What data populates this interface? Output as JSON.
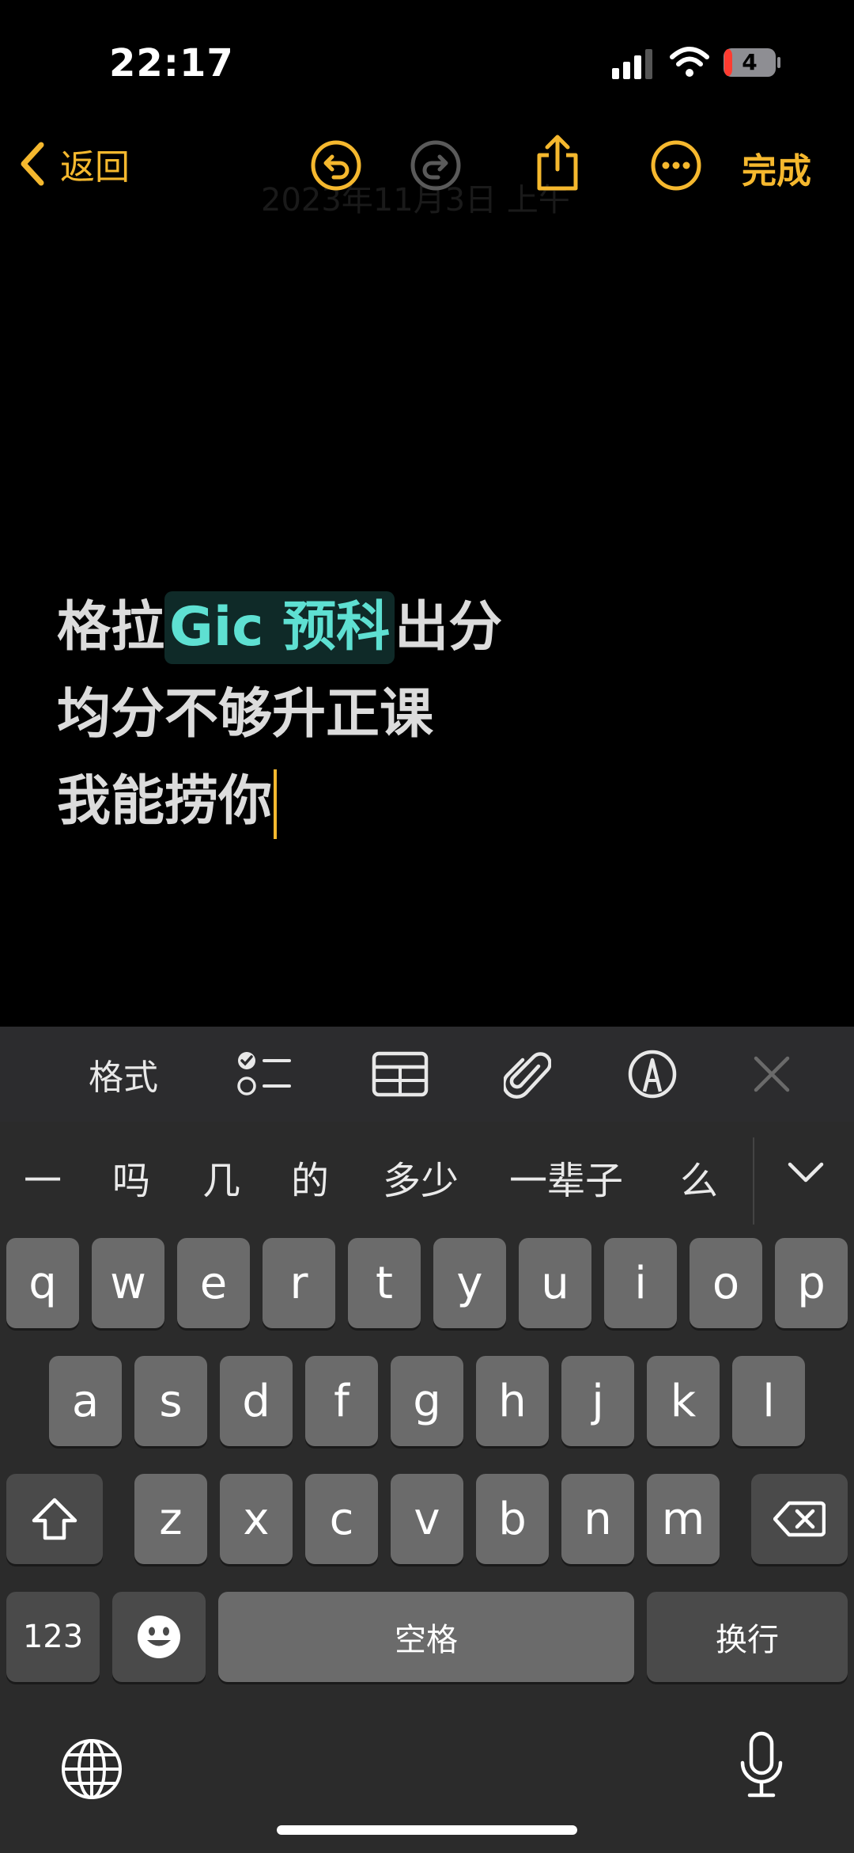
{
  "status": {
    "time": "22:17",
    "battery": "4"
  },
  "nav": {
    "back_label": "返回",
    "done_label": "完成",
    "ghost_date": "2023年11月3日 上午"
  },
  "note": {
    "line1": {
      "before": "格拉",
      "marked": "Gic 预科",
      "after": "出分"
    },
    "line2": "均分不够升正课",
    "line3": "我能捞你"
  },
  "toolbar": {
    "format_label": "格式"
  },
  "candidates": [
    "一",
    "吗",
    "几",
    "的",
    "多少",
    "一辈子",
    "么"
  ],
  "keys": {
    "row1": [
      "q",
      "w",
      "e",
      "r",
      "t",
      "y",
      "u",
      "i",
      "o",
      "p"
    ],
    "row2": [
      "a",
      "s",
      "d",
      "f",
      "g",
      "h",
      "j",
      "k",
      "l"
    ],
    "row3": [
      "z",
      "x",
      "c",
      "v",
      "b",
      "n",
      "m"
    ],
    "numbers": "123",
    "space": "空格",
    "return": "换行"
  },
  "colors": {
    "accent": "#F5B82E",
    "marked_text": "#5EE0D2"
  }
}
